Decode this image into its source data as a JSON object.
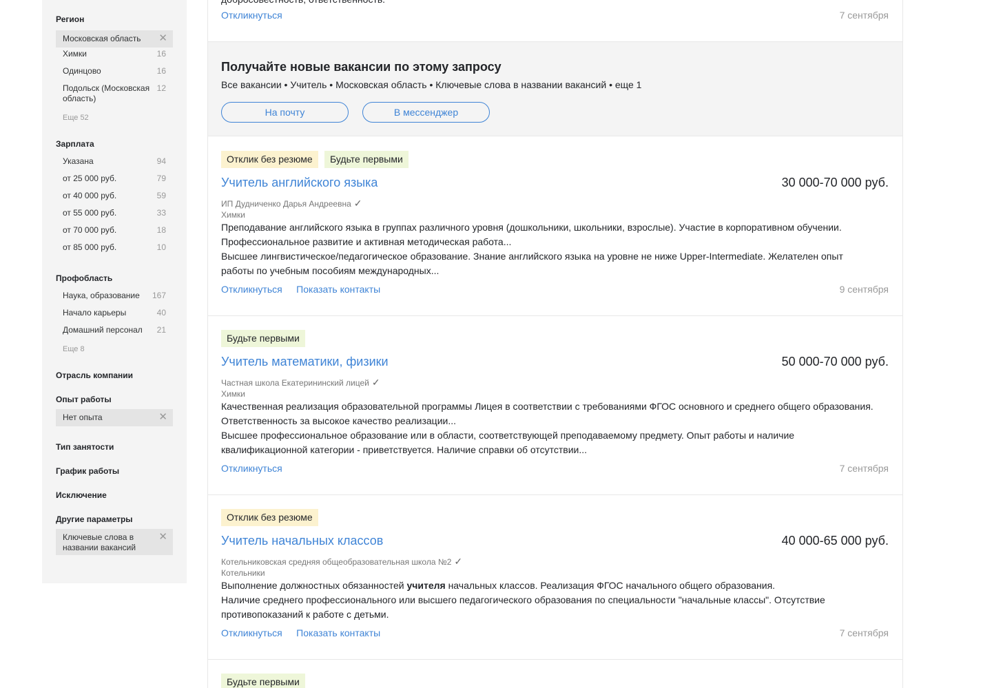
{
  "sidebar": {
    "region": {
      "title": "Регион",
      "selected": "Московская область",
      "items": [
        {
          "label": "Химки",
          "count": "16"
        },
        {
          "label": "Одинцово",
          "count": "16"
        },
        {
          "label": "Подольск (Московская область)",
          "count": "12"
        }
      ],
      "more": "Еще 52"
    },
    "salary": {
      "title": "Зарплата",
      "items": [
        {
          "label": "Указана",
          "count": "94"
        },
        {
          "label": "от 25 000 руб.",
          "count": "79"
        },
        {
          "label": "от 40 000 руб.",
          "count": "59"
        },
        {
          "label": "от 55 000 руб.",
          "count": "33"
        },
        {
          "label": "от 70 000 руб.",
          "count": "18"
        },
        {
          "label": "от 85 000 руб.",
          "count": "10"
        }
      ]
    },
    "profarea": {
      "title": "Профобласть",
      "items": [
        {
          "label": "Наука, образование",
          "count": "167"
        },
        {
          "label": "Начало карьеры",
          "count": "40"
        },
        {
          "label": "Домашний персонал",
          "count": "21"
        }
      ],
      "more": "Еще 8"
    },
    "industry": {
      "title": "Отрасль компании"
    },
    "experience": {
      "title": "Опыт работы",
      "selected": "Нет опыта"
    },
    "employment": {
      "title": "Тип занятости"
    },
    "schedule": {
      "title": "График работы"
    },
    "exclusion": {
      "title": "Исключение"
    },
    "other": {
      "title": "Другие параметры",
      "selected": "Ключевые слова в названии вакансий"
    }
  },
  "top": {
    "partial_text": "добросовестность, ответственность.",
    "respond": "Откликнуться",
    "date": "7 сентября"
  },
  "subscribe": {
    "title": "Получайте новые вакансии по этому запросу",
    "tags": "Все вакансии • Учитель • Московская область • Ключевые слова в названии вакансий • еще 1",
    "email_button": "На почту",
    "messenger_button": "В мессенджер"
  },
  "vacancies": [
    {
      "badge1": "Отклик без резюме",
      "badge2": "Будьте первыми",
      "title": "Учитель английского языка",
      "salary": "30 000-70 000 руб.",
      "company": "ИП Дудниченко Дарья Андреевна",
      "city": "Химки",
      "resp1": "Преподавание английского языка в группах различного уровня (дошкольники, школьники, взрослые). Участие в корпоративном обучении.",
      "resp2": "Профессиональное развитие и активная методическая работа...",
      "req1": "Высшее лингвистическое/педагогическое образование. Знание английского языка на уровне не ниже Upper-Intermediate. Желателен опыт",
      "req2": "работы по учебным пособиям международных...",
      "respond": "Откликнуться",
      "contacts": "Показать контакты",
      "date": "9 сентября"
    },
    {
      "badge1": "Будьте первыми",
      "title": "Учитель математики, физики",
      "salary": "50 000-70 000 руб.",
      "company": "Частная школа Екатерининский лицей",
      "city": "Химки",
      "resp1": "Качественная реализация образовательной программы Лицея в соответствии с требованиями ФГОС основного и среднего общего образования.",
      "resp2": "Ответственность за высокое качество реализации...",
      "req1": "Высшее профессиональное образование или в области, соответствующей преподаваемому предмету. Опыт работы и наличие",
      "req2": "квалификационной категории - приветствуется. Наличие справки об отсутствии...",
      "respond": "Откликнуться",
      "date": "7 сентября"
    },
    {
      "badge1": "Отклик без резюме",
      "title": "Учитель начальных классов",
      "salary": "40 000-65 000 руб.",
      "company": "Котельниковская средняя общеобразовательная школа №2",
      "city": "Котельники",
      "resp_pre": "Выполнение должностных обязанностей ",
      "resp_bold": "учителя",
      "resp_post": " начальных классов. Реализация ФГОС начального общего образования.",
      "req1": "Наличие среднего профессионального или высшего педагогического образования по специальности \"начальные классы\". Отсутствие",
      "req2": "противопоказаний к работе с детьми.",
      "respond": "Откликнуться",
      "contacts": "Показать контакты",
      "date": "7 сентября"
    },
    {
      "badge1": "Будьте первыми"
    }
  ],
  "icons": {
    "close": "close-icon",
    "check": "verified-check-icon"
  },
  "colors": {
    "link": "#3f84d6",
    "badge_yellow": "#fcf2cf",
    "badge_green": "#eef6d9",
    "sidebar_bg": "#f4f4f4"
  }
}
